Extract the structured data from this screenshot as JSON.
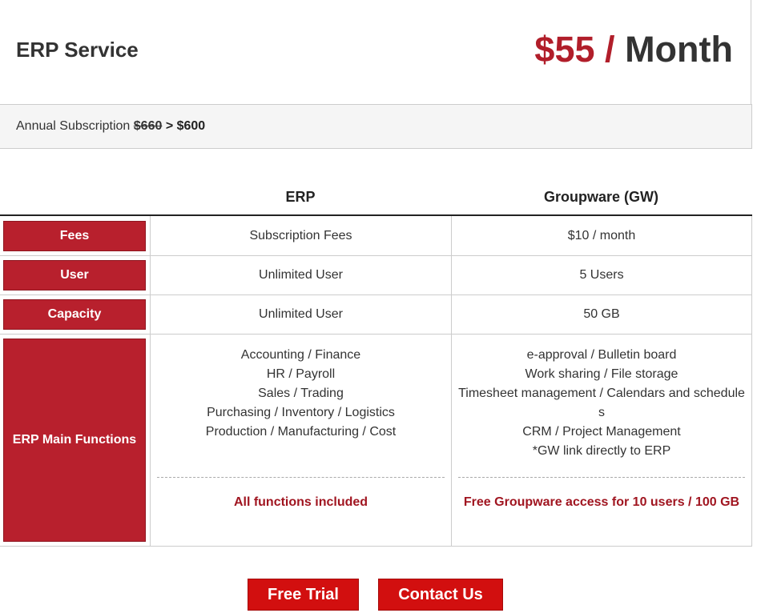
{
  "header": {
    "service_name": "ERP Service",
    "price_amount": "$55",
    "price_slash": "/",
    "price_period": "Month"
  },
  "annual": {
    "label": "Annual Subscription",
    "old_price": "$660",
    "arrow": ">",
    "new_price": "$600"
  },
  "table": {
    "columns": [
      "ERP",
      "Groupware (GW)"
    ],
    "rows": [
      {
        "label": "Fees",
        "erp": "Subscription Fees",
        "gw": "$10 / month"
      },
      {
        "label": "User",
        "erp": "Unlimited User",
        "gw": "5 Users"
      },
      {
        "label": "Capacity",
        "erp": "Unlimited User",
        "gw": "50 GB"
      }
    ],
    "functions": {
      "label": "ERP Main Functions",
      "erp_items": [
        "Accounting / Finance",
        "HR / Payroll",
        "Sales / Trading",
        "Purchasing / Inventory / Logistics",
        "Production / Manufacturing / Cost"
      ],
      "gw_items": [
        "e-approval / Bulletin board",
        "Work sharing / File storage",
        "Timesheet management / Calendars and schedules",
        "CRM / Project Management",
        "*GW link directly to ERP"
      ],
      "erp_note": "All functions included",
      "gw_note": "Free Groupware access for 10 users / 100 GB"
    }
  },
  "buttons": {
    "free_trial": "Free Trial",
    "contact_us": "Contact Us"
  },
  "colors": {
    "accent_red": "#b8202d",
    "price_red": "#b11e2a",
    "button_red": "#d20f0f",
    "note_red": "#a01520"
  }
}
